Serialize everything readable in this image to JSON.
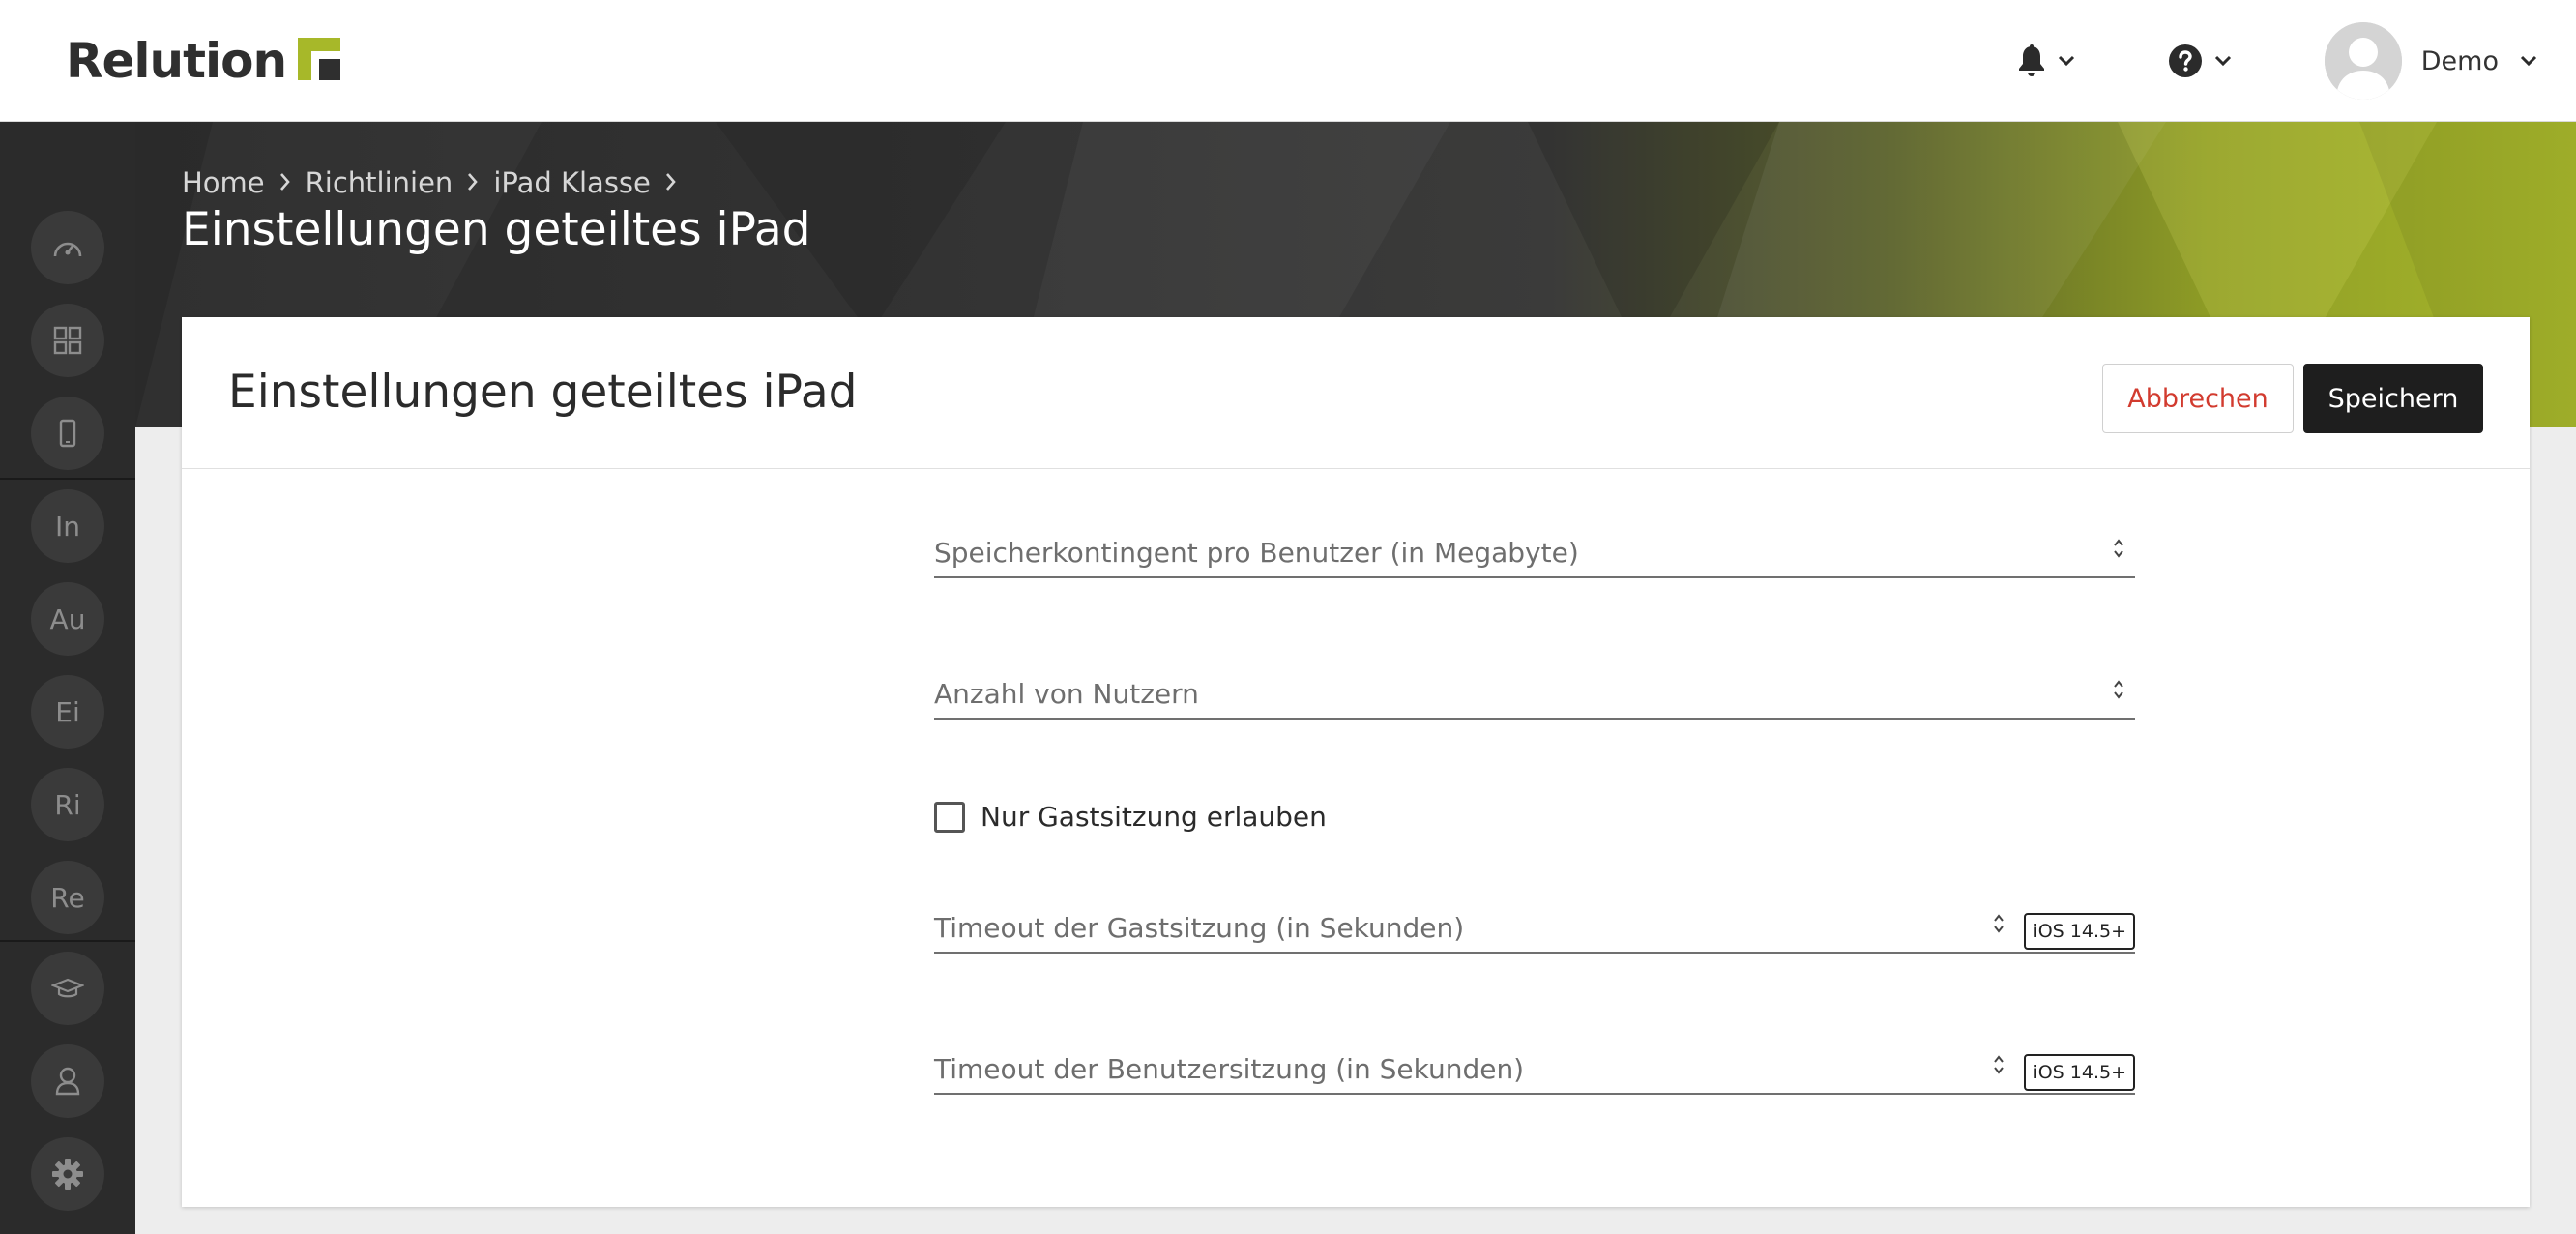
{
  "header": {
    "logo_text": "Relution",
    "brand_color": "#a7b829",
    "notifications_icon": "bell-icon",
    "help_icon": "question-circle-icon",
    "user_name": "Demo"
  },
  "sidebar": {
    "items": [
      {
        "icon": "dashboard-icon",
        "label": ""
      },
      {
        "icon": "grid-icon",
        "label": ""
      },
      {
        "icon": "device-icon",
        "label": ""
      },
      {
        "label": "In"
      },
      {
        "label": "Au"
      },
      {
        "label": "Ei"
      },
      {
        "label": "Ri"
      },
      {
        "label": "Re"
      },
      {
        "icon": "graduation-cap-icon",
        "label": ""
      },
      {
        "icon": "user-icon",
        "label": ""
      },
      {
        "icon": "gear-icon",
        "label": ""
      }
    ]
  },
  "breadcrumb": {
    "items": [
      "Home",
      "Richtlinien",
      "iPad Klasse"
    ]
  },
  "page_title": "Einstellungen geteiltes iPad",
  "card": {
    "title": "Einstellungen geteiltes iPad",
    "cancel_label": "Abbrechen",
    "save_label": "Speichern"
  },
  "form": {
    "storage_quota_label": "Speicherkontingent pro Benutzer (in Megabyte)",
    "user_count_label": "Anzahl von Nutzern",
    "guest_only_label": "Nur Gastsitzung erlauben",
    "guest_only_checked": false,
    "guest_timeout_label": "Timeout der Gastsitzung (in Sekunden)",
    "guest_timeout_badge": "iOS 14.5+",
    "user_timeout_label": "Timeout der Benutzersitzung (in Sekunden)",
    "user_timeout_badge": "iOS 14.5+"
  }
}
